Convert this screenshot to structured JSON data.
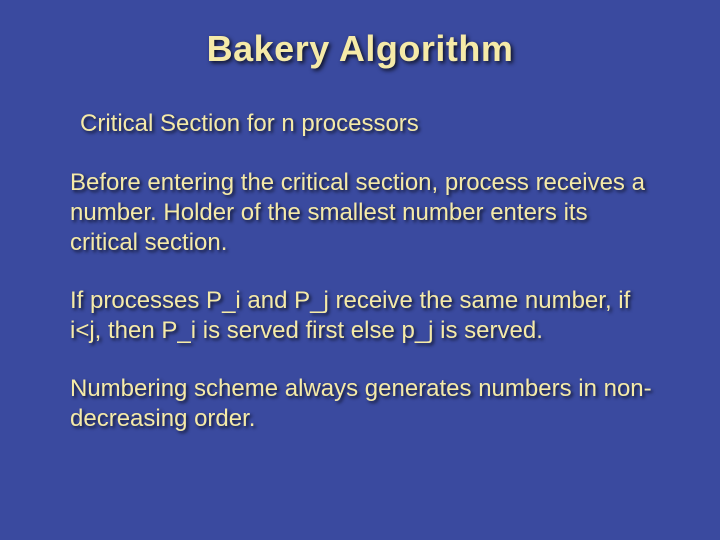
{
  "slide": {
    "title": "Bakery Algorithm",
    "subtitle": "Critical Section for n processors",
    "paragraphs": [
      "Before entering the critical section, process receives a number. Holder of the smallest number enters its critical section.",
      "If processes P_i and P_j receive the same number, if i<j, then P_i is served first else p_j is served.",
      "Numbering scheme always generates numbers in non-decreasing order."
    ]
  }
}
